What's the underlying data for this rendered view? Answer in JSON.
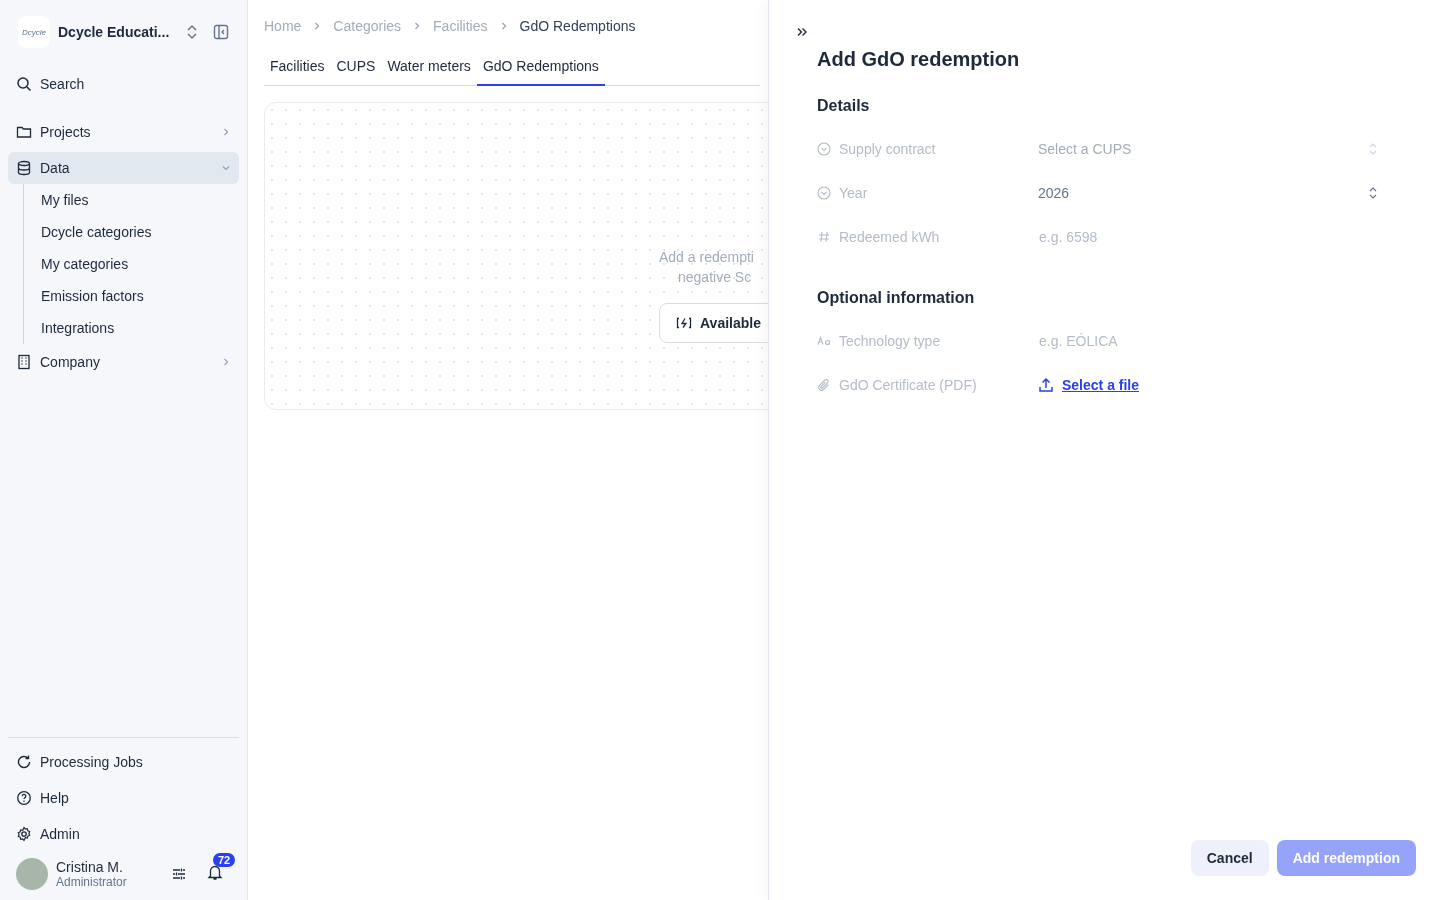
{
  "sidebar": {
    "org_logo": "Dcycle",
    "org_name": "Dcycle Educati...",
    "search": "Search",
    "items": [
      {
        "label": "Projects",
        "expanded": false,
        "selected": false
      },
      {
        "label": "Data",
        "expanded": true,
        "selected": true,
        "children": [
          {
            "label": "My files"
          },
          {
            "label": "Dcycle categories"
          },
          {
            "label": "My categories"
          },
          {
            "label": "Emission factors"
          },
          {
            "label": "Integrations"
          }
        ]
      },
      {
        "label": "Company",
        "expanded": false,
        "selected": false
      }
    ],
    "bottom_items": [
      {
        "label": "Processing Jobs"
      },
      {
        "label": "Help"
      },
      {
        "label": "Admin"
      }
    ],
    "user": {
      "name": "Cristina M.",
      "role": "Administrator",
      "notifications": "72"
    }
  },
  "breadcrumb": [
    "Home",
    "Categories",
    "Facilities",
    "GdO Redemptions"
  ],
  "tabs": [
    {
      "label": "Facilities",
      "selected": false
    },
    {
      "label": "CUPS",
      "selected": false
    },
    {
      "label": "Water meters",
      "selected": false
    },
    {
      "label": "GdO Redemptions",
      "selected": true
    }
  ],
  "empty_state": {
    "description": [
      "Add a redempti",
      "negative Sc"
    ],
    "button": "Available"
  },
  "drawer": {
    "title": "Add GdO redemption",
    "sections": [
      {
        "title": "Details",
        "fields": [
          {
            "kind": "select",
            "label": "Supply contract",
            "placeholder": "Select a CUPS"
          },
          {
            "kind": "select",
            "label": "Year",
            "value": "2026"
          },
          {
            "kind": "number",
            "label": "Redeemed kWh",
            "placeholder": "e.g. 6598"
          }
        ]
      },
      {
        "title": "Optional information",
        "fields": [
          {
            "kind": "text",
            "label": "Technology type",
            "placeholder": "e.g. EÓLICA"
          },
          {
            "kind": "file",
            "label": "GdO Certificate (PDF)",
            "link": "Select a file"
          }
        ]
      }
    ],
    "cancel": "Cancel",
    "submit": {
      "label": "Add redemption",
      "disabled": true
    }
  }
}
